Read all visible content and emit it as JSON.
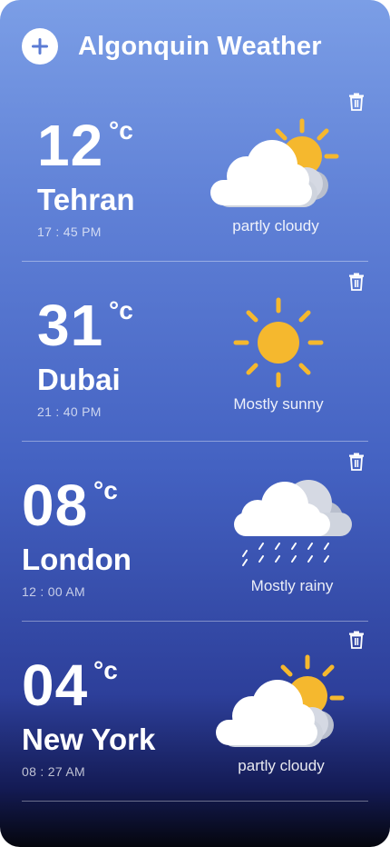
{
  "app": {
    "title": "Algonquin Weather"
  },
  "cities": [
    {
      "temp": "12",
      "unit": "°c",
      "name": "Tehran",
      "time": "17 : 45 PM",
      "condition": "partly cloudy",
      "icon": "partly-cloudy-icon"
    },
    {
      "temp": "31",
      "unit": "°c",
      "name": "Dubai",
      "time": "21 : 40 PM",
      "condition": "Mostly sunny",
      "icon": "sun-icon"
    },
    {
      "temp": "08",
      "unit": "°c",
      "name": "London",
      "time": "12 : 00 AM",
      "condition": "Mostly rainy",
      "icon": "rain-cloud-icon"
    },
    {
      "temp": "04",
      "unit": "°c",
      "name": "New York",
      "time": "08 : 27 AM",
      "condition": "partly cloudy",
      "icon": "partly-cloudy-icon"
    }
  ],
  "colors": {
    "sun": "#f5b82e",
    "cloud": "#ffffff",
    "accent": "#4f6fd0"
  }
}
